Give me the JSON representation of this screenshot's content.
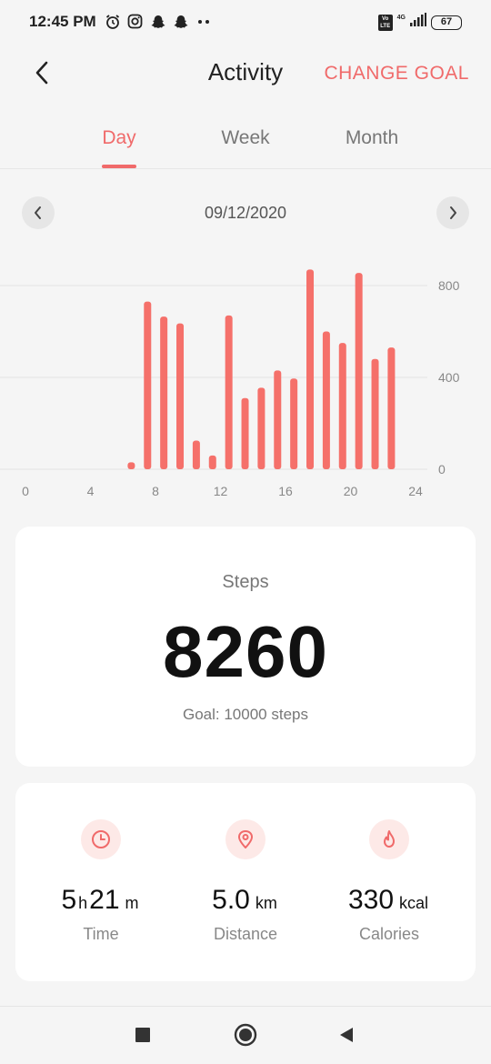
{
  "status_bar": {
    "time": "12:45 PM",
    "icons": [
      "alarm-icon",
      "instagram-icon",
      "snapchat-icon",
      "snapchat-icon",
      "more-dots-icon"
    ],
    "volte": "Vo LTE",
    "network": "4G",
    "battery": "67"
  },
  "header": {
    "title": "Activity",
    "action": "CHANGE GOAL"
  },
  "tabs": [
    {
      "label": "Day",
      "active": true
    },
    {
      "label": "Week",
      "active": false
    },
    {
      "label": "Month",
      "active": false
    }
  ],
  "date_nav": {
    "date": "09/12/2020"
  },
  "chart_data": {
    "type": "bar",
    "x": [
      7,
      8,
      9,
      10,
      11,
      12,
      13,
      14,
      15,
      16,
      17,
      18,
      19,
      20,
      21,
      22,
      23
    ],
    "values": [
      30,
      730,
      665,
      635,
      125,
      60,
      670,
      310,
      355,
      430,
      395,
      870,
      600,
      550,
      855,
      480,
      530
    ],
    "xticks": [
      "0",
      "4",
      "8",
      "12",
      "16",
      "20",
      "24"
    ],
    "yticks": [
      "0",
      "400",
      "800"
    ],
    "xlim": [
      0,
      24
    ],
    "ylim": [
      0,
      800
    ],
    "bar_color": "#f5706a",
    "grid": true
  },
  "steps": {
    "label": "Steps",
    "value": "8260",
    "goal": "Goal: 10000 steps"
  },
  "stats": [
    {
      "icon": "clock-icon",
      "parts": [
        {
          "num": "5"
        },
        {
          "unit": "h"
        },
        {
          "num": "21"
        },
        {
          "unit": "m"
        }
      ],
      "label": "Time"
    },
    {
      "icon": "location-pin-icon",
      "parts": [
        {
          "num": "5.0"
        },
        {
          "unit": "km"
        }
      ],
      "label": "Distance"
    },
    {
      "icon": "flame-icon",
      "parts": [
        {
          "num": "330"
        },
        {
          "unit": "kcal"
        }
      ],
      "label": "Calories"
    }
  ],
  "colors": {
    "accent": "#f06a6a",
    "bar": "#f5706a",
    "icon_bg": "#fde9e7"
  }
}
